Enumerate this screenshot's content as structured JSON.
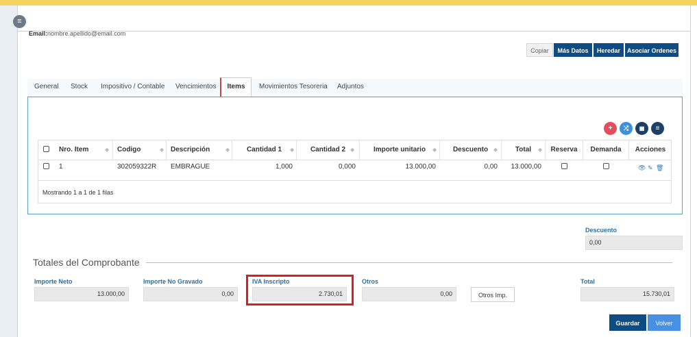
{
  "header": {
    "menu_icon": "hamburger-icon",
    "email_label": "Email:",
    "email_value": "nombre.apellido@email.com"
  },
  "toolbar": {
    "copiar": "Copiar",
    "mas_datos": "Más Datos",
    "heredar": "Heredar",
    "asociar_ordenes": "Asociar Ordenes"
  },
  "tabs": [
    {
      "label": "General"
    },
    {
      "label": "Stock"
    },
    {
      "label": "Impositivo / Contable"
    },
    {
      "label": "Vencimientos"
    },
    {
      "label": "Items"
    },
    {
      "label": "Movimientos Tesoreria"
    },
    {
      "label": "Adjuntos"
    }
  ],
  "table_actions": [
    "plus-icon",
    "shuffle-icon",
    "grid-icon",
    "list-icon"
  ],
  "table": {
    "columns": [
      "Nro. Item",
      "Codigo",
      "Descripción",
      "Cantidad 1",
      "Cantidad 2",
      "Importe unitario",
      "Descuento",
      "Total",
      "Reserva",
      "Demanda",
      "Acciones"
    ],
    "rows": [
      {
        "nro": "1",
        "codigo": "302059322R",
        "descripcion": "EMBRAGUE",
        "cantidad1": "1,000",
        "cantidad2": "0,000",
        "importe": "13.000,00",
        "descuento": "0,00",
        "total": "13.000,00"
      }
    ],
    "footer": "Mostrando 1 a 1 de 1 filas"
  },
  "descuento": {
    "label": "Descuento",
    "value": "0,00"
  },
  "totales": {
    "title": "Totales del Comprobante",
    "importe_neto": {
      "label": "Importe Neto",
      "value": "13.000,00"
    },
    "importe_no_gravado": {
      "label": "Importe No Gravado",
      "value": "0,00"
    },
    "iva_inscripto": {
      "label": "IVA Inscripto",
      "value": "2.730,01"
    },
    "otros": {
      "label": "Otros",
      "value": "0,00"
    },
    "otros_imp": "Otros Imp.",
    "total": {
      "label": "Total",
      "value": "15.730,01"
    }
  },
  "footer_buttons": {
    "guardar": "Guardar",
    "volver": "Volver"
  },
  "colors": {
    "accent": "#0f4c81",
    "secondary": "#4a90e2",
    "highlight": "#e01b1b",
    "topbar": "#f4d35e"
  }
}
